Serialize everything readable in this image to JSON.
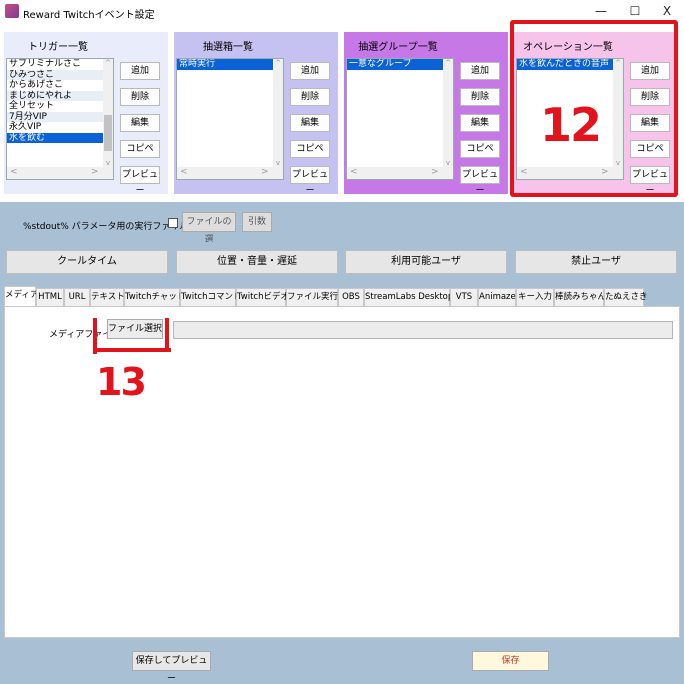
{
  "window": {
    "title": "Reward Twitchイベント設定",
    "minimize": "—",
    "maximize": "☐",
    "close": "X"
  },
  "scroll_glyphs": {
    "left": "<",
    "right": ">",
    "up": "^",
    "down": "v"
  },
  "panels": [
    {
      "title": "トリガー一覧",
      "color": "#e9edfb",
      "items": [
        "サブリミナルさこ",
        "ひみつさこ",
        "からあげさこ",
        "まじめにやれよ",
        "全リセット",
        "7月分VIP",
        "永久VIP",
        "水を飲む"
      ],
      "selected_index": 7,
      "buttons": [
        "追加",
        "削除",
        "編集",
        "コピペ",
        "プレビュー"
      ]
    },
    {
      "title": "抽選箱一覧",
      "color": "#c5c1f1",
      "items": [
        "常時実行"
      ],
      "selected_index": 0,
      "buttons": [
        "追加",
        "削除",
        "編集",
        "コピペ",
        "プレビュー"
      ]
    },
    {
      "title": "抽選グループ一覧",
      "color": "#c678e6",
      "items": [
        "一意なグループ"
      ],
      "selected_index": 0,
      "buttons": [
        "追加",
        "削除",
        "編集",
        "コピペ",
        "プレビュー"
      ]
    },
    {
      "title": "オペレーション一覧",
      "color": "#f6c3ea",
      "items": [
        "水を飲んだときの音声"
      ],
      "selected_index": 0,
      "buttons": [
        "追加",
        "削除",
        "編集",
        "コピペ",
        "プレビュー"
      ]
    }
  ],
  "stdout": {
    "label": "%stdout% パラメータ用の実行ファイルを使う",
    "file_button": "ファイルの選",
    "args_button": "引数"
  },
  "big_buttons": [
    "クールタイム",
    "位置・音量・遅延",
    "利用可能ユーザ",
    "禁止ユーザ"
  ],
  "tabs": [
    "メディア",
    "HTML",
    "URL",
    "テキスト",
    "Twitchチャット",
    "Twitchコマンド",
    "Twitchビデオ",
    "ファイル実行",
    "OBS",
    "StreamLabs Desktop",
    "VTS",
    "Animaze",
    "キー入力",
    "棒読みちゃん",
    "たぬえさき"
  ],
  "active_tab_index": 0,
  "media": {
    "label": "メディアファイル",
    "select_button": "ファイル選択",
    "path_value": ""
  },
  "footer": {
    "save_preview": "保存してプレビュー",
    "save": "保存"
  },
  "annotations": {
    "box_label": "12",
    "underline_label": "13",
    "color": "#e3131b"
  }
}
